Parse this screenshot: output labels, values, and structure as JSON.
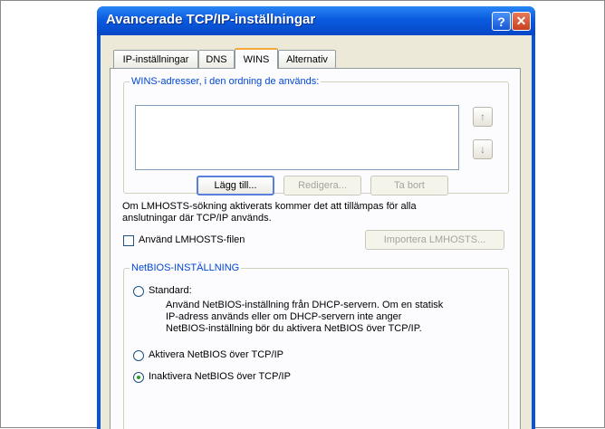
{
  "window": {
    "title": "Avancerade TCP/IP-inställningar",
    "help_glyph": "?",
    "close_glyph": "✕"
  },
  "tabs": [
    {
      "label": "IP-inställningar",
      "active": false
    },
    {
      "label": "DNS",
      "active": false
    },
    {
      "label": "WINS",
      "active": true
    },
    {
      "label": "Alternativ",
      "active": false
    }
  ],
  "wins": {
    "group_label": "WINS-adresser, i den ordning de används:",
    "up_glyph": "↑",
    "down_glyph": "↓",
    "add_button": "Lägg till...",
    "edit_button": "Redigera...",
    "remove_button": "Ta bort"
  },
  "lmhosts": {
    "description_line1": "Om LMHOSTS-sökning aktiverats kommer det att tillämpas för alla",
    "description_line2": "anslutningar där TCP/IP används.",
    "checkbox_label": "Använd LMHOSTS-filen",
    "checked": false,
    "import_button": "Importera LMHOSTS..."
  },
  "netbios": {
    "group_label": "NetBIOS-INSTÄLLNING",
    "options": [
      {
        "label": "Standard:",
        "checked": false
      },
      {
        "label": "Aktivera NetBIOS över TCP/IP",
        "checked": false
      },
      {
        "label": "Inaktivera NetBIOS över TCP/IP",
        "checked": true
      }
    ],
    "standard_desc_line1": "Använd NetBIOS-inställning från DHCP-servern. Om en statisk",
    "standard_desc_line2": "IP-adress används eller om DHCP-servern inte anger",
    "standard_desc_line3": "NetBIOS-inställning bör du aktivera NetBIOS över TCP/IP."
  }
}
